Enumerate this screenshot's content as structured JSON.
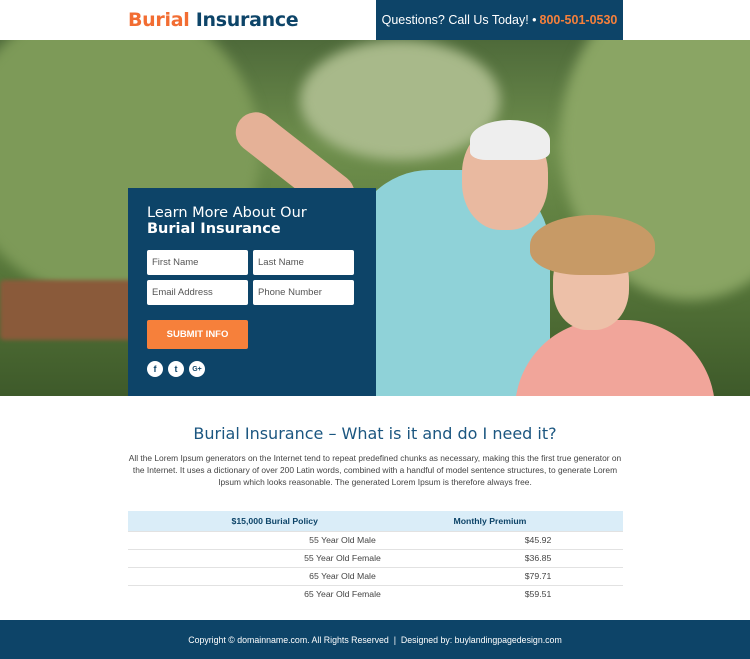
{
  "header": {
    "logo_part1": "Burial",
    "logo_part2": "Insurance",
    "call_text": "Questions? Call Us Today! •",
    "phone": "800-501-0530"
  },
  "form": {
    "title_line1": "Learn More About Our",
    "title_line2": "Burial Insurance",
    "first_name_placeholder": "First Name",
    "last_name_placeholder": "Last Name",
    "email_placeholder": "Email Address",
    "phone_placeholder": "Phone Number",
    "submit_label": "SUBMIT INFO",
    "social": [
      {
        "icon": "facebook-icon",
        "glyph": "f"
      },
      {
        "icon": "twitter-icon",
        "glyph": "t"
      },
      {
        "icon": "google-plus-icon",
        "glyph": "G+"
      }
    ]
  },
  "content": {
    "heading": "Burial Insurance – What is it and do I need it?",
    "paragraph": "All the Lorem Ipsum generators on the Internet tend to repeat predefined chunks as necessary, making this the first true generator on the Internet. It uses a dictionary of over 200 Latin words, combined with a handful of model sentence structures, to generate Lorem Ipsum which looks reasonable. The generated Lorem Ipsum is therefore always free."
  },
  "table": {
    "headers": [
      "$15,000 Burial Policy",
      "Monthly Premium"
    ],
    "rows": [
      [
        "55 Year Old Male",
        "$45.92"
      ],
      [
        "55 Year Old Female",
        "$36.85"
      ],
      [
        "65 Year Old Male",
        "$79.71"
      ],
      [
        "65 Year Old Female",
        "$59.51"
      ]
    ]
  },
  "footer": {
    "text": "Copyright © domainname.com. All Rights Reserved  |  Designed by: buylandingpagedesign.com"
  },
  "colors": {
    "primary": "#0d4468",
    "accent": "#f6803b"
  }
}
